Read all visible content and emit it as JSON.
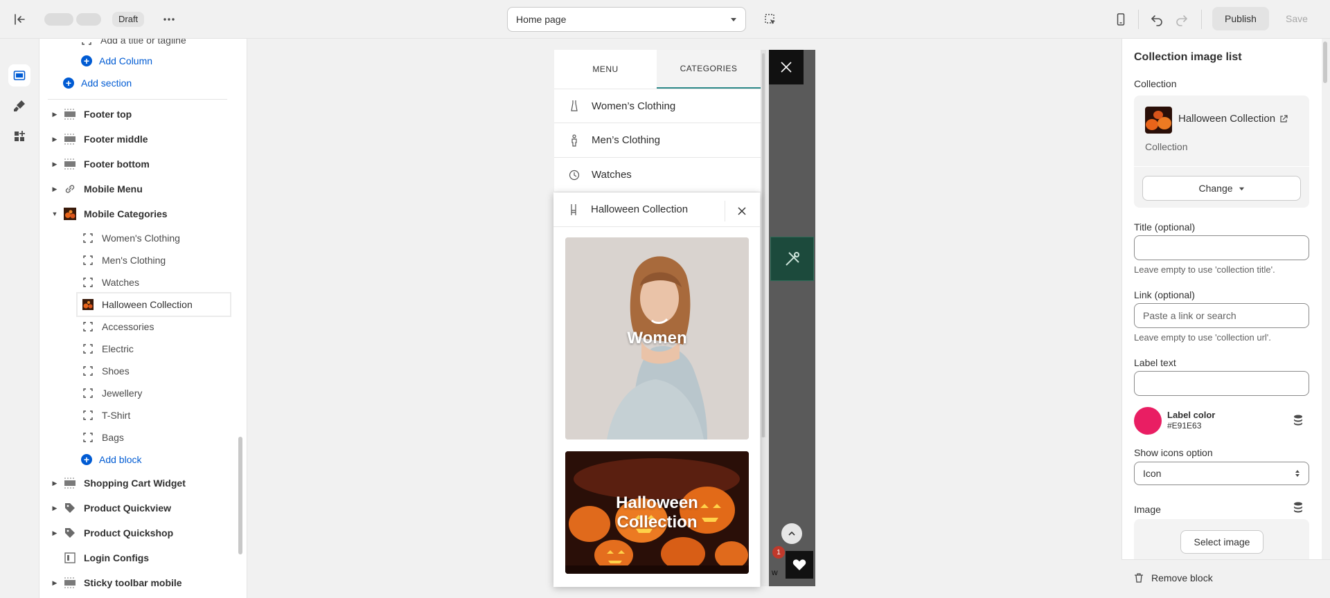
{
  "topbar": {
    "draft_label": "Draft",
    "page_select": "Home page",
    "publish_label": "Publish",
    "save_label": "Save"
  },
  "sidebar": {
    "partial_top_text": "Add a title or tagline",
    "add_column": "Add Column",
    "add_section": "Add section",
    "sections": [
      {
        "label": "Footer top",
        "icon": "layout-section-icon"
      },
      {
        "label": "Footer middle",
        "icon": "layout-section-icon"
      },
      {
        "label": "Footer bottom",
        "icon": "layout-section-icon"
      },
      {
        "label": "Mobile Menu",
        "icon": "link-icon"
      },
      {
        "label": "Mobile Categories",
        "icon": "halloween-thumb-icon"
      }
    ],
    "blocks": [
      {
        "label": "Women's Clothing"
      },
      {
        "label": "Men's Clothing"
      },
      {
        "label": "Watches"
      },
      {
        "label": "Halloween Collection"
      },
      {
        "label": "Accessories"
      },
      {
        "label": "Electric"
      },
      {
        "label": "Shoes"
      },
      {
        "label": "Jewellery"
      },
      {
        "label": "T-Shirt"
      },
      {
        "label": "Bags"
      }
    ],
    "add_block": "Add block",
    "after_sections": [
      {
        "label": "Shopping Cart Widget",
        "icon": "layout-section-icon"
      },
      {
        "label": "Product Quickview",
        "icon": "tag-icon"
      },
      {
        "label": "Product Quickshop",
        "icon": "tag-icon"
      },
      {
        "label": "Login Configs",
        "icon": "layout-block-icon"
      },
      {
        "label": "Sticky toolbar mobile",
        "icon": "layout-section-icon"
      }
    ]
  },
  "preview": {
    "tab_menu": "MENU",
    "tab_categories": "CATEGORIES",
    "categories": [
      {
        "label": "Women’s Clothing",
        "icon": "dress-icon"
      },
      {
        "label": "Men’s Clothing",
        "icon": "man-icon"
      },
      {
        "label": "Watches",
        "icon": "clock-icon"
      }
    ],
    "popup_title": "Halloween Collection",
    "tile_women": "Women",
    "tile_halloween_line1": "Halloween",
    "tile_halloween_line2": "Collection",
    "badge_count": "1",
    "bottom_partial_text": "w"
  },
  "panel": {
    "title": "Collection image list",
    "collection_label": "Collection",
    "collection_name": "Halloween Collection",
    "collection_sub": "Collection",
    "change_label": "Change",
    "title_label": "Title (optional)",
    "title_value": "",
    "title_hint": "Leave empty to use 'collection title'.",
    "link_label": "Link (optional)",
    "link_placeholder": "Paste a link or search",
    "link_hint": "Leave empty to use 'collection url'.",
    "label_text_label": "Label text",
    "label_text_value": "",
    "label_color_label": "Label color",
    "label_color_value": "#E91E63",
    "icons_option_label": "Show icons option",
    "icons_option_value": "Icon",
    "image_label": "Image",
    "select_image_label": "Select image",
    "remove_block_label": "Remove block"
  },
  "colors": {
    "accent_blue": "#005bd3",
    "label_color": "#E91E63",
    "active_tab_underline": "#2d8a8a"
  }
}
